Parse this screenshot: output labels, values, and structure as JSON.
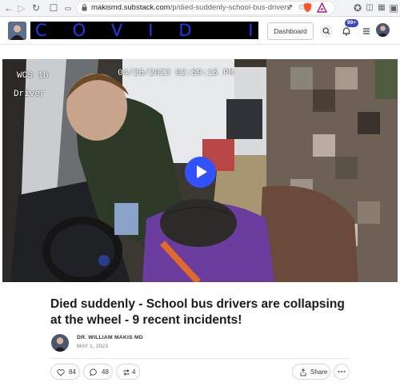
{
  "browser": {
    "url_host": "makismd.substack.com",
    "url_path": "/p/died-suddenly-school-bus-drivers"
  },
  "header": {
    "banner_text": "COVID INTEL",
    "dashboard_label": "Dashboard",
    "notification_badge": "99+"
  },
  "video": {
    "overlay_camera": "WCS 18",
    "overlay_timestamp": "04/26/2023 02:59:15 PM",
    "overlay_label": "Driver"
  },
  "article": {
    "title": "Died suddenly - School bus drivers are collapsing at the wheel - 9 recent incidents!",
    "author": "DR. WILLIAM MAKIS MD",
    "date": "MAY 1, 2023"
  },
  "actions": {
    "likes": "84",
    "comments": "48",
    "restacks": "4",
    "share_label": "Share"
  },
  "colors": {
    "accent": "#3352ff",
    "banner_text": "#1e3cf0"
  }
}
